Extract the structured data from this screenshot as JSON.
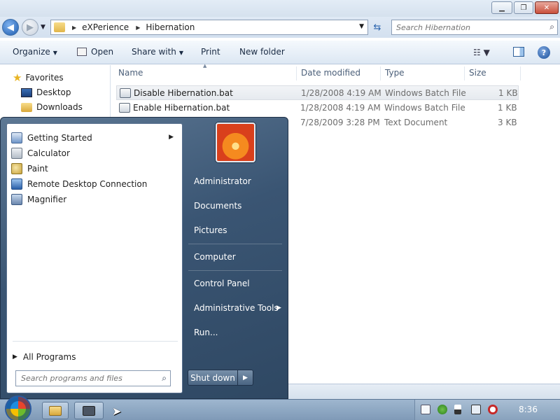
{
  "explorer": {
    "breadcrumb": [
      "eXPerience",
      "Hibernation"
    ],
    "search_placeholder": "Search Hibernation",
    "toolbar": {
      "organize": "Organize",
      "open": "Open",
      "share_with": "Share with",
      "print": "Print",
      "new_folder": "New folder"
    },
    "nav": {
      "favorites": "Favorites",
      "items": [
        "Desktop",
        "Downloads"
      ]
    },
    "columns": {
      "name": "Name",
      "date": "Date modified",
      "type": "Type",
      "size": "Size"
    },
    "files": [
      {
        "name": "Disable Hibernation.bat",
        "date": "1/28/2008 4:19 AM",
        "type": "Windows Batch File",
        "size": "1 KB"
      },
      {
        "name": "Enable Hibernation.bat",
        "date": "1/28/2008 4:19 AM",
        "type": "Windows Batch File",
        "size": "1 KB"
      },
      {
        "name": "",
        "date": "7/28/2009 3:28 PM",
        "type": "Text Document",
        "size": "3 KB"
      }
    ]
  },
  "start_menu": {
    "programs": [
      "Getting Started",
      "Calculator",
      "Paint",
      "Remote Desktop Connection",
      "Magnifier"
    ],
    "all_programs": "All Programs",
    "search_placeholder": "Search programs and files",
    "right": {
      "user": "Administrator",
      "documents": "Documents",
      "pictures": "Pictures",
      "computer": "Computer",
      "control_panel": "Control Panel",
      "admin_tools": "Administrative Tools",
      "run": "Run..."
    },
    "shutdown": "Shut down"
  },
  "taskbar": {
    "clock": "8:36"
  }
}
